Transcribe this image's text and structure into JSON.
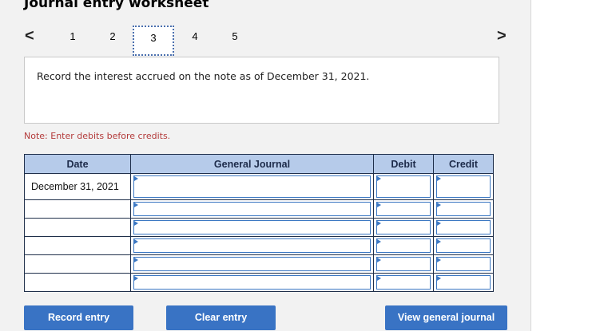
{
  "title": "Journal entry worksheet",
  "pager": {
    "prev_glyph": "<",
    "next_glyph": ">",
    "pages": [
      "1",
      "2",
      "3",
      "4",
      "5"
    ],
    "active_page": "3"
  },
  "instruction": "Record the interest accrued on the note as of December 31, 2021.",
  "note": "Note: Enter debits before credits.",
  "table": {
    "headers": {
      "date": "Date",
      "journal": "General Journal",
      "debit": "Debit",
      "credit": "Credit"
    },
    "rows": [
      {
        "date": "December 31, 2021",
        "account": "",
        "debit": "",
        "credit": ""
      },
      {
        "date": "",
        "account": "",
        "debit": "",
        "credit": ""
      },
      {
        "date": "",
        "account": "",
        "debit": "",
        "credit": ""
      },
      {
        "date": "",
        "account": "",
        "debit": "",
        "credit": ""
      },
      {
        "date": "",
        "account": "",
        "debit": "",
        "credit": ""
      },
      {
        "date": "",
        "account": "",
        "debit": "",
        "credit": ""
      }
    ]
  },
  "buttons": {
    "record": "Record entry",
    "clear": "Clear entry",
    "view": "View general journal"
  },
  "colors": {
    "header_bg": "#b6cbea",
    "button_bg": "#3973c4",
    "note_text": "#b33a3a"
  }
}
